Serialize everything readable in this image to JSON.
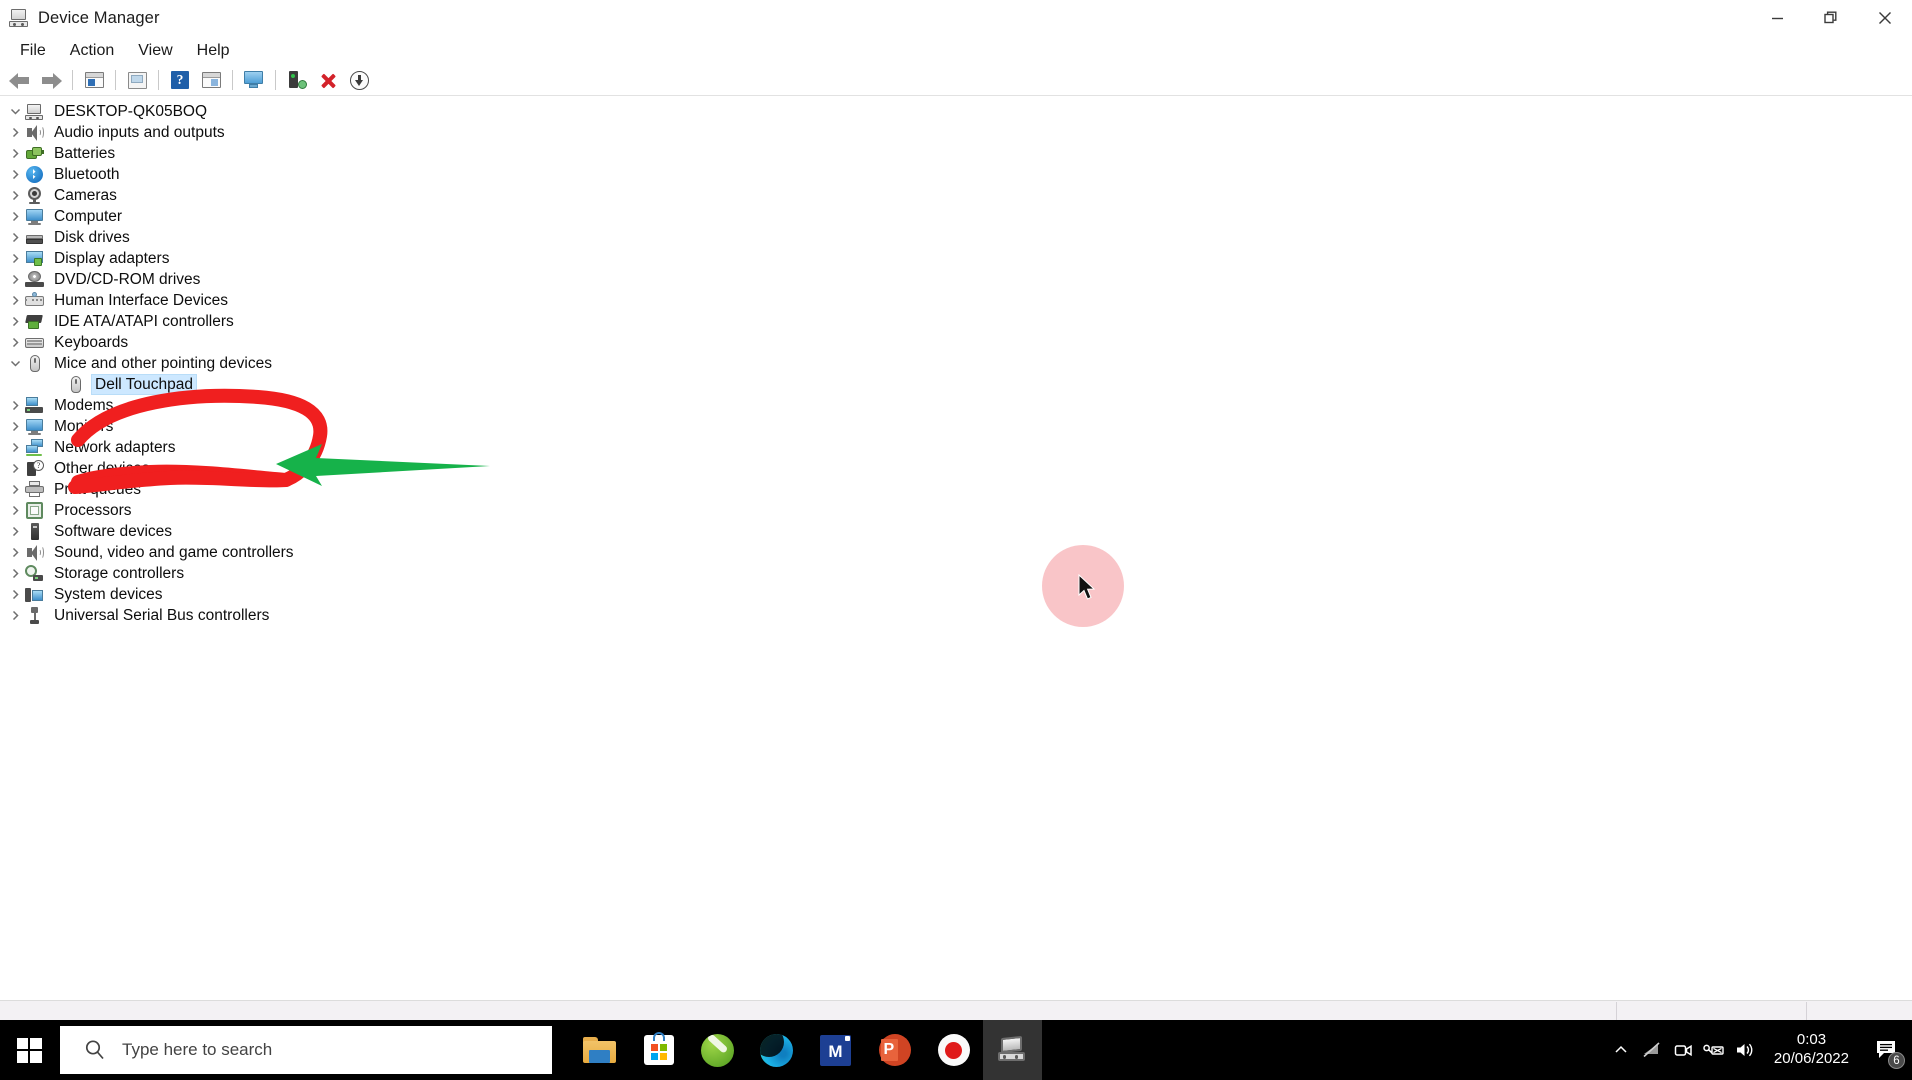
{
  "window": {
    "title": "Device Manager",
    "icon": "device-manager-icon",
    "controls": {
      "minimize": "Minimize",
      "restore": "Restore",
      "close": "Close"
    }
  },
  "menubar": {
    "items": [
      {
        "label": "File"
      },
      {
        "label": "Action"
      },
      {
        "label": "View"
      },
      {
        "label": "Help"
      }
    ]
  },
  "toolbar": {
    "items": [
      {
        "name": "back-arrow-icon",
        "tooltip": "Back"
      },
      {
        "name": "forward-arrow-icon",
        "tooltip": "Forward"
      },
      {
        "name": "separator-1"
      },
      {
        "name": "show-hide-console-tree-icon",
        "tooltip": "Show/Hide Console Tree"
      },
      {
        "name": "separator-2"
      },
      {
        "name": "properties-icon",
        "tooltip": "Properties"
      },
      {
        "name": "separator-3"
      },
      {
        "name": "help-icon",
        "tooltip": "Help"
      },
      {
        "name": "update-driver-icon",
        "tooltip": "Update driver"
      },
      {
        "name": "separator-4"
      },
      {
        "name": "show-hidden-devices-icon",
        "tooltip": "Show hidden devices"
      },
      {
        "name": "separator-5"
      },
      {
        "name": "scan-for-hardware-changes-icon",
        "tooltip": "Scan for hardware changes"
      },
      {
        "name": "uninstall-device-icon",
        "tooltip": "Uninstall device"
      },
      {
        "name": "disable-device-icon",
        "tooltip": "Disable device"
      }
    ]
  },
  "tree": {
    "root": {
      "label": "DESKTOP-QK05BOQ",
      "icon": "computer-icon",
      "expanded": true
    },
    "nodes": [
      {
        "label": "Audio inputs and outputs",
        "icon": "speaker-icon",
        "expanded": false,
        "level": 1
      },
      {
        "label": "Batteries",
        "icon": "battery-icon",
        "expanded": false,
        "level": 1
      },
      {
        "label": "Bluetooth",
        "icon": "bluetooth-icon",
        "expanded": false,
        "level": 1
      },
      {
        "label": "Cameras",
        "icon": "camera-icon",
        "expanded": false,
        "level": 1
      },
      {
        "label": "Computer",
        "icon": "monitor-icon",
        "expanded": false,
        "level": 1
      },
      {
        "label": "Disk drives",
        "icon": "disk-drive-icon",
        "expanded": false,
        "level": 1
      },
      {
        "label": "Display adapters",
        "icon": "display-adapter-icon",
        "expanded": false,
        "level": 1
      },
      {
        "label": "DVD/CD-ROM drives",
        "icon": "dvd-drive-icon",
        "expanded": false,
        "level": 1
      },
      {
        "label": "Human Interface Devices",
        "icon": "hid-icon",
        "expanded": false,
        "level": 1
      },
      {
        "label": "IDE ATA/ATAPI controllers",
        "icon": "ide-controller-icon",
        "expanded": false,
        "level": 1
      },
      {
        "label": "Keyboards",
        "icon": "keyboard-icon",
        "expanded": false,
        "level": 1
      },
      {
        "label": "Mice and other pointing devices",
        "icon": "mouse-icon",
        "expanded": true,
        "level": 1
      },
      {
        "label": "Dell Touchpad",
        "icon": "mouse-icon",
        "expanded": null,
        "level": 2,
        "selected": true
      },
      {
        "label": "Modems",
        "icon": "modem-icon",
        "expanded": false,
        "level": 1
      },
      {
        "label": "Monitors",
        "icon": "monitor-icon",
        "expanded": false,
        "level": 1
      },
      {
        "label": "Network adapters",
        "icon": "network-adapter-icon",
        "expanded": false,
        "level": 1
      },
      {
        "label": "Other devices",
        "icon": "other-device-icon",
        "expanded": false,
        "level": 1
      },
      {
        "label": "Print queues",
        "icon": "printer-icon",
        "expanded": false,
        "level": 1
      },
      {
        "label": "Processors",
        "icon": "processor-icon",
        "expanded": false,
        "level": 1
      },
      {
        "label": "Software devices",
        "icon": "software-device-icon",
        "expanded": false,
        "level": 1
      },
      {
        "label": "Sound, video and game controllers",
        "icon": "speaker-icon",
        "expanded": false,
        "level": 1
      },
      {
        "label": "Storage controllers",
        "icon": "storage-controller-icon",
        "expanded": false,
        "level": 1
      },
      {
        "label": "System devices",
        "icon": "system-device-icon",
        "expanded": false,
        "level": 1
      },
      {
        "label": "Universal Serial Bus controllers",
        "icon": "usb-controller-icon",
        "expanded": false,
        "level": 1
      }
    ]
  },
  "annotations": {
    "circle_color": "#f01f1f",
    "arrow_color": "#16b24a",
    "click_highlight_color": "#f9c0c3",
    "circle_target": "Dell Touchpad",
    "arrow_target": "Dell Touchpad"
  },
  "taskbar": {
    "start": {
      "name": "start-button",
      "label": "Start"
    },
    "search": {
      "placeholder": "Type here to search",
      "icon": "search-icon"
    },
    "apps": [
      {
        "name": "file-explorer",
        "label": "File Explorer",
        "active": false
      },
      {
        "name": "microsoft-store",
        "label": "Microsoft Store",
        "active": false
      },
      {
        "name": "green-app",
        "label": "Green App",
        "active": false
      },
      {
        "name": "microsoft-edge",
        "label": "Microsoft Edge",
        "active": false
      },
      {
        "name": "blue-m-app",
        "label": "M",
        "active": false
      },
      {
        "name": "powerpoint",
        "label": "PowerPoint",
        "active": false
      },
      {
        "name": "screen-recorder",
        "label": "Screen Recorder",
        "active": false
      },
      {
        "name": "device-manager",
        "label": "Device Manager",
        "active": true
      }
    ],
    "tray": [
      {
        "name": "show-hidden-icons-chevron",
        "glyph": "^"
      },
      {
        "name": "network-disconnected-icon"
      },
      {
        "name": "camera-icon"
      },
      {
        "name": "battery-icon"
      },
      {
        "name": "volume-icon"
      }
    ],
    "clock": {
      "time": "0:03",
      "date": "20/06/2022"
    },
    "notifications": {
      "name": "action-center-icon",
      "badge": "6"
    }
  }
}
